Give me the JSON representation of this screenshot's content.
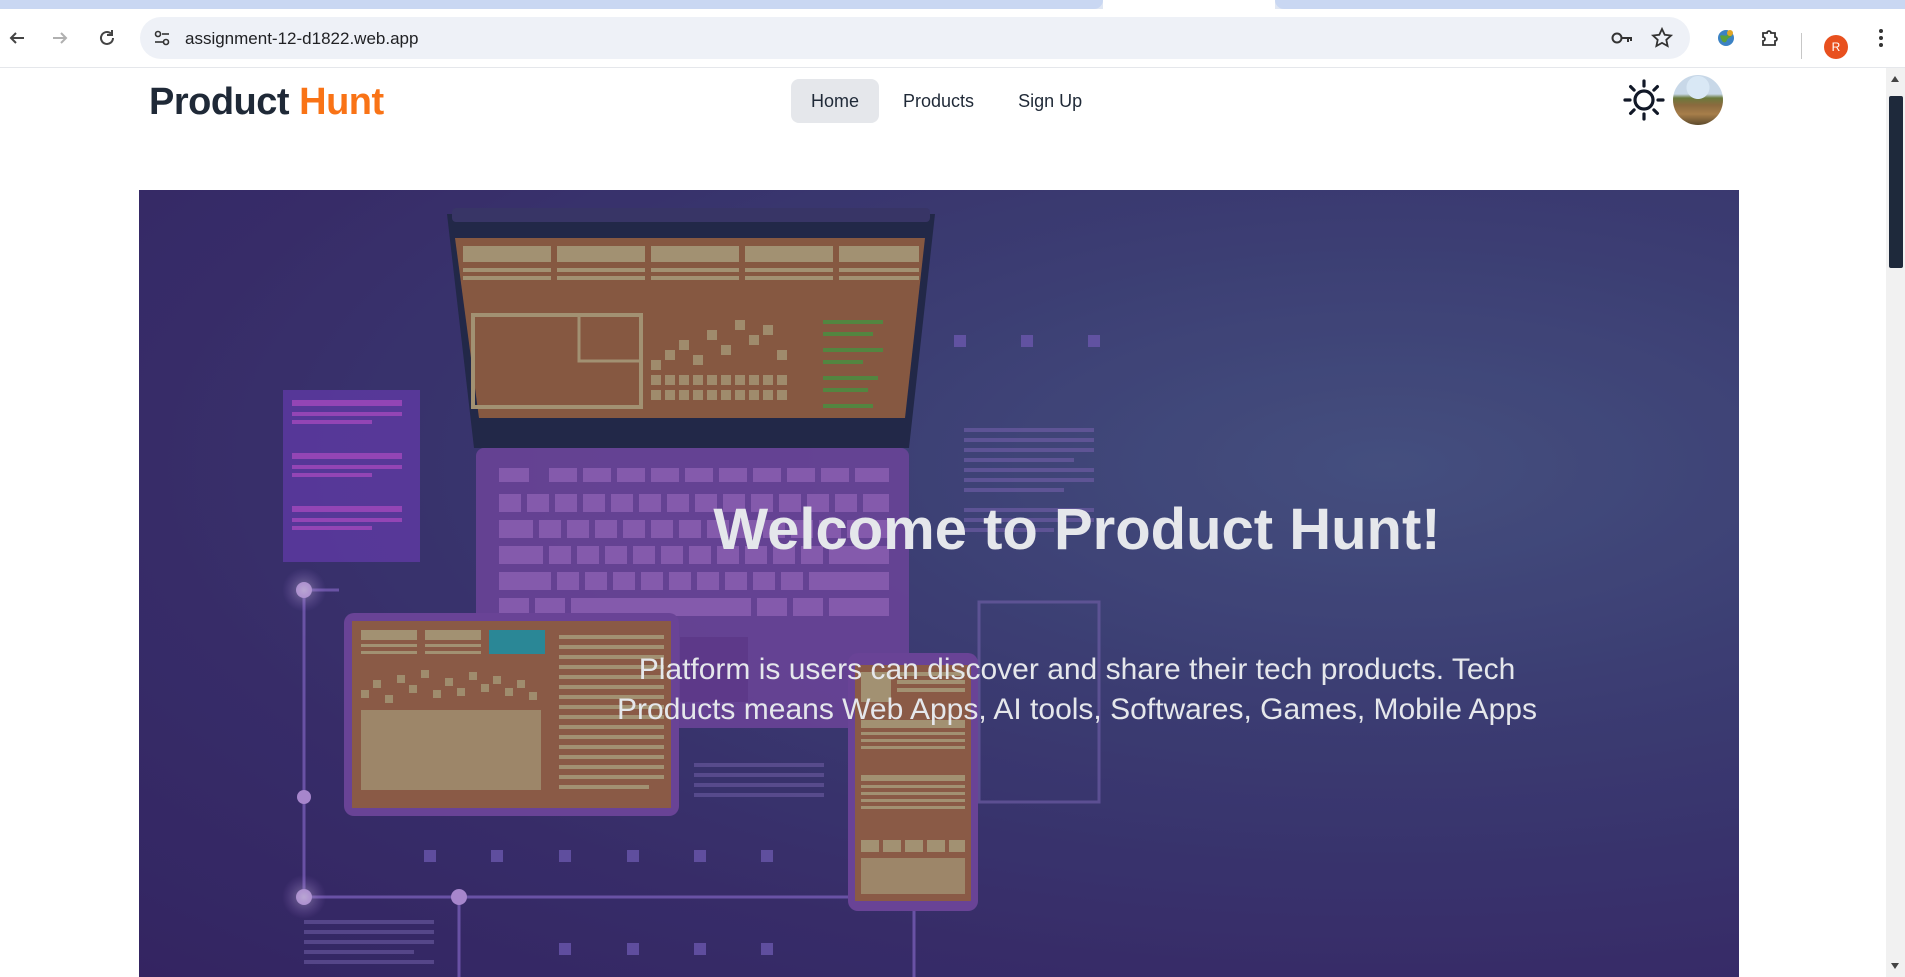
{
  "browser": {
    "url": "assignment-12-d1822.web.app",
    "profile_initial": "R"
  },
  "site": {
    "logo_part1": "Product",
    "logo_part2": "Hunt",
    "nav": [
      {
        "label": "Home",
        "active": true
      },
      {
        "label": "Products",
        "active": false
      },
      {
        "label": "Sign Up",
        "active": false
      }
    ],
    "theme_icon": "sun-icon",
    "avatar_icon": "user-avatar"
  },
  "hero": {
    "title": "Welcome to Product Hunt!",
    "description": "Platform is users can discover and share their tech products. Tech Products means Web Apps, AI tools, Softwares, Games, Mobile Apps"
  },
  "colors": {
    "accent": "#f97316",
    "text": "#1f2937",
    "hero_bg": "#3a2f6e"
  }
}
